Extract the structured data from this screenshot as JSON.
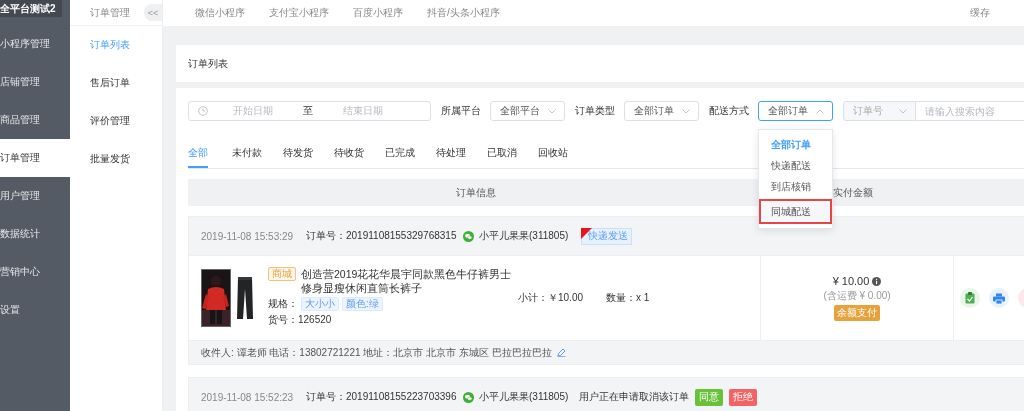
{
  "sidebar": {
    "brand": "全平台测试2",
    "items": [
      {
        "label": "小程序管理",
        "selected": false
      },
      {
        "label": "店铺管理",
        "selected": false
      },
      {
        "label": "商品管理",
        "selected": false
      },
      {
        "label": "订单管理",
        "selected": true
      },
      {
        "label": "用户管理",
        "selected": false
      },
      {
        "label": "数据统计",
        "selected": false
      },
      {
        "label": "营销中心",
        "selected": false
      },
      {
        "label": "设置",
        "selected": false
      }
    ]
  },
  "subnav": {
    "title": "订单管理",
    "collapse": "<<",
    "items": [
      {
        "label": "订单列表",
        "selected": true
      },
      {
        "label": "售后订单",
        "selected": false
      },
      {
        "label": "评价管理",
        "selected": false
      },
      {
        "label": "批量发货",
        "selected": false
      }
    ]
  },
  "topnav": {
    "tabs": [
      {
        "label": "微信小程序",
        "selected": false
      },
      {
        "label": "支付宝小程序",
        "selected": false
      },
      {
        "label": "百度小程序",
        "selected": false
      },
      {
        "label": "抖音/头条小程序",
        "selected": false
      }
    ],
    "cache": "缓存"
  },
  "page_title": "订单列表",
  "filters": {
    "date_start_placeholder": "开始日期",
    "date_separator": "至",
    "date_end_placeholder": "结束日期",
    "selects": [
      {
        "label": "所属平台",
        "value": "全部平台",
        "expanded": false
      },
      {
        "label": "订单类型",
        "value": "全部订单",
        "expanded": false
      },
      {
        "label": "配送方式",
        "value": "全部订单",
        "expanded": true,
        "options": [
          {
            "label": "全部订单",
            "selected": true,
            "highlighted": false
          },
          {
            "label": "快递配送",
            "selected": false,
            "highlighted": false
          },
          {
            "label": "到店核销",
            "selected": false,
            "highlighted": false
          },
          {
            "label": "同城配送",
            "selected": false,
            "highlighted": true
          }
        ]
      }
    ],
    "search_type": "订单号",
    "search_placeholder": "请输入搜索内容"
  },
  "status_tabs": [
    {
      "label": "全部",
      "selected": true
    },
    {
      "label": "未付款",
      "selected": false
    },
    {
      "label": "待发货",
      "selected": false
    },
    {
      "label": "待收货",
      "selected": false
    },
    {
      "label": "已完成",
      "selected": false
    },
    {
      "label": "待处理",
      "selected": false
    },
    {
      "label": "已取消",
      "selected": false
    },
    {
      "label": "回收站",
      "selected": false
    }
  ],
  "table_header": [
    "订单信息",
    "实付金额"
  ],
  "orders": [
    {
      "time": "2019-11-08 15:53:29",
      "order_no_label": "订单号：",
      "order_no": "20191108155329768315",
      "buyer": "小平儿果果(311805)",
      "delivery_tag": "快递发送",
      "product": {
        "kind": "picture",
        "source_tag": "商城",
        "title": "创造营2019花花华晨宇同款黑色牛仔裤男士修身显瘦休闲直筒长裤子",
        "spec_label": "规格：",
        "specs": [
          "大小小",
          "颜色:绿"
        ],
        "sku": "货号：126520",
        "subtotal": "小计：￥10.00",
        "quantity": "数量：x 1"
      },
      "total": "¥ 10.00",
      "shipping": "(含运费 ¥ 0.00)",
      "payment": "余额支付",
      "recipient": "收件人: 谭老师 电话：13802721221 地址：北京市 北京市 东城区 巴拉巴拉巴拉"
    },
    {
      "time": "2019-11-08 15:52:23",
      "order_no_label": "订单号：",
      "order_no": "20191108155223703396",
      "buyer": "小平儿果果(311805)",
      "notice": "用户正在申请取消该订单",
      "actions": [
        {
          "label": "同意",
          "kind": "agree"
        },
        {
          "label": "拒绝",
          "kind": "reject"
        }
      ]
    }
  ]
}
